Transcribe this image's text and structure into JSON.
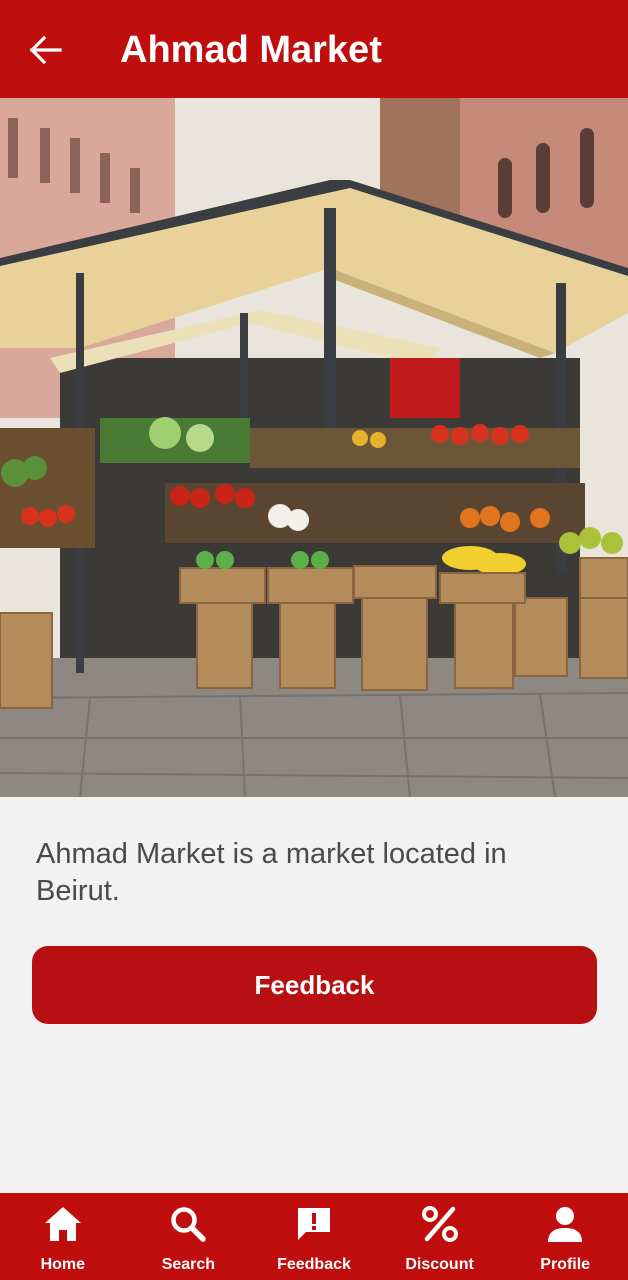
{
  "header": {
    "title": "Ahmad Market",
    "back_icon": "arrow-left-icon"
  },
  "hero": {
    "image_subject": "outdoor produce market stall under canopy"
  },
  "main": {
    "description": "Ahmad Market is a market located in Beirut.",
    "feedback_button": "Feedback"
  },
  "nav": {
    "items": [
      {
        "label": "Home",
        "icon": "home-icon"
      },
      {
        "label": "Search",
        "icon": "search-icon"
      },
      {
        "label": "Feedback",
        "icon": "feedback-icon"
      },
      {
        "label": "Discount",
        "icon": "percent-icon"
      },
      {
        "label": "Profile",
        "icon": "person-icon"
      }
    ]
  },
  "colors": {
    "brand_red": "#c00d0d",
    "background": "#f2f2f2",
    "text_gray": "#4a4a4a"
  }
}
